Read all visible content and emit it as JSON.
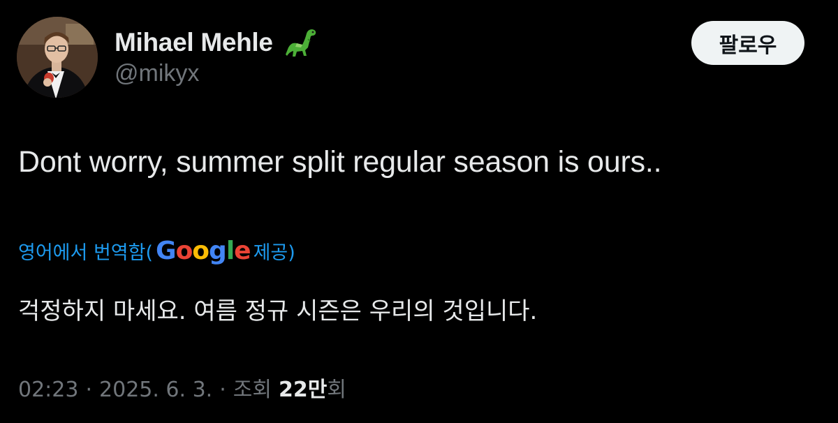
{
  "author": {
    "display_name": "Mihael Mehle",
    "handle": "@mikyx",
    "badge_icon": "dinosaur-emoji-icon"
  },
  "follow_button": {
    "label": "팔로우"
  },
  "tweet": {
    "text": "Dont worry, summer split regular season is ours..",
    "translation_label_prefix": "영어에서 번역함(",
    "translation_provider_letters": [
      "G",
      "o",
      "o",
      "g",
      "l",
      "e"
    ],
    "translation_label_suffix": " 제공)",
    "translated_text": "걱정하지 마세요. 여름 정규 시즌은 우리의 것입니다."
  },
  "meta": {
    "time": "02:23",
    "separator": "·",
    "date": "2025. 6. 3.",
    "views_prefix": "조회",
    "views_count": "22만",
    "views_suffix": "회"
  },
  "colors": {
    "background": "#000000",
    "primary_text": "#e7e9ea",
    "secondary_text": "#71767b",
    "link_blue": "#1d9bf0",
    "follow_button_bg": "#eff3f4",
    "google_blue": "#4285f4",
    "google_red": "#ea4335",
    "google_yellow": "#fbbc05",
    "google_green": "#34a853"
  }
}
